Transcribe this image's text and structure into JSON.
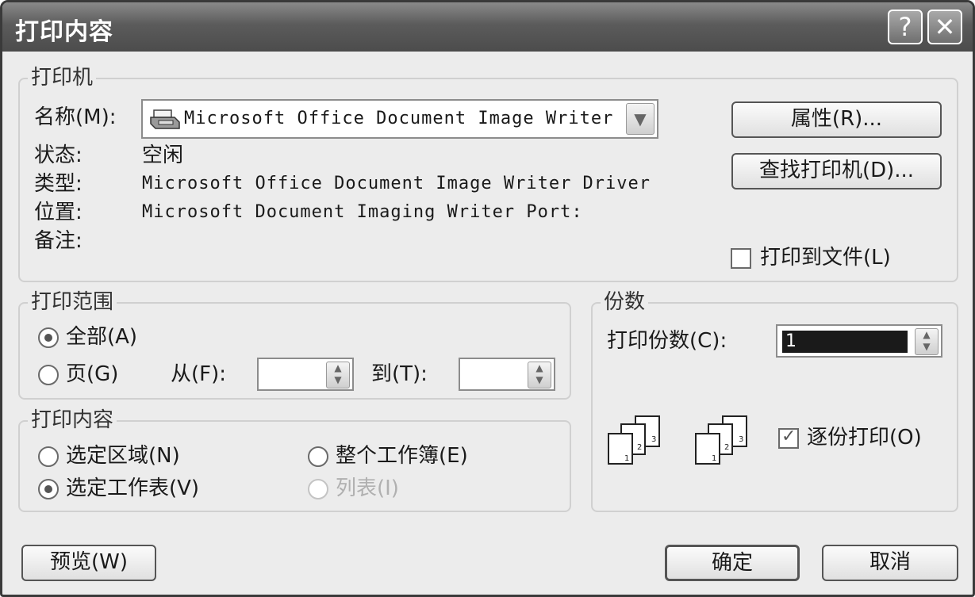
{
  "window": {
    "title": "打印内容",
    "help_glyph": "?",
    "close_glyph": "✕"
  },
  "printer": {
    "legend": "打印机",
    "name_label": "名称(M):",
    "name_value": "Microsoft Office Document Image Writer",
    "status_label": "状态:",
    "status_value": "空闲",
    "type_label": "类型:",
    "type_value": "Microsoft Office Document Image Writer Driver",
    "location_label": "位置:",
    "location_value": "Microsoft Document Imaging Writer Port:",
    "comment_label": "备注:",
    "properties_button": "属性(R)...",
    "find_printer_button": "查找打印机(D)...",
    "print_to_file_label": "打印到文件(L)",
    "print_to_file_checked": false
  },
  "range": {
    "legend": "打印范围",
    "all_label": "全部(A)",
    "pages_label": "页(G)",
    "from_label": "从(F):",
    "to_label": "到(T):",
    "from_value": "",
    "to_value": "",
    "selected": "all"
  },
  "content": {
    "legend": "打印内容",
    "selection_label": "选定区域(N)",
    "workbook_label": "整个工作簿(E)",
    "active_sheets_label": "选定工作表(V)",
    "list_label": "列表(I)",
    "selected": "active_sheets",
    "list_disabled": true
  },
  "copies": {
    "legend": "份数",
    "count_label": "打印份数(C):",
    "count_value": "1",
    "collate_label": "逐份打印(O)",
    "collate_checked": true
  },
  "buttons": {
    "preview": "预览(W)",
    "ok": "确定",
    "cancel": "取消"
  },
  "colors": {
    "title_bar": "#5b5b5b",
    "dialog_bg": "#ececec",
    "selection": "#1a1a1a"
  }
}
